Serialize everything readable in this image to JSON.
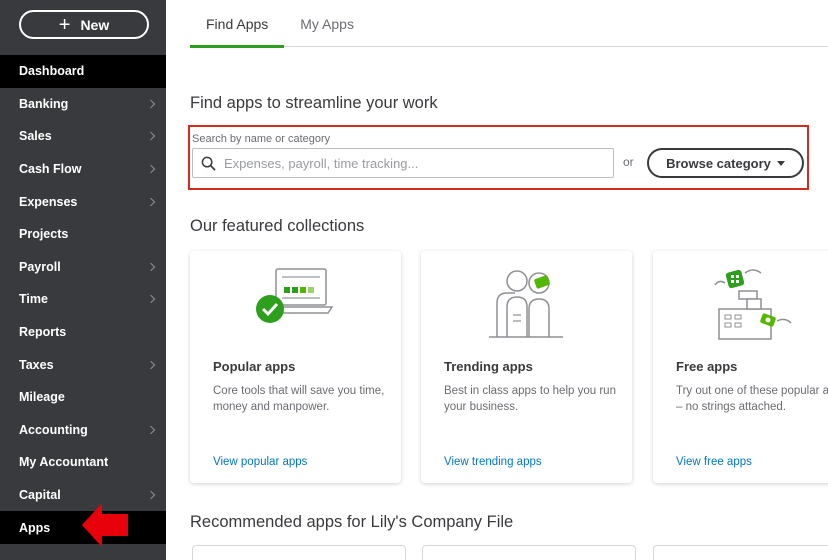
{
  "sidebar": {
    "new_button": {
      "label": "New"
    },
    "items": [
      {
        "label": "Dashboard",
        "has_chevron": false
      },
      {
        "label": "Banking",
        "has_chevron": true
      },
      {
        "label": "Sales",
        "has_chevron": true
      },
      {
        "label": "Cash Flow",
        "has_chevron": true
      },
      {
        "label": "Expenses",
        "has_chevron": true
      },
      {
        "label": "Projects",
        "has_chevron": false
      },
      {
        "label": "Payroll",
        "has_chevron": true
      },
      {
        "label": "Time",
        "has_chevron": true
      },
      {
        "label": "Reports",
        "has_chevron": false
      },
      {
        "label": "Taxes",
        "has_chevron": true
      },
      {
        "label": "Mileage",
        "has_chevron": false
      },
      {
        "label": "Accounting",
        "has_chevron": true
      },
      {
        "label": "My Accountant",
        "has_chevron": false
      },
      {
        "label": "Capital",
        "has_chevron": true
      },
      {
        "label": "Apps",
        "has_chevron": false,
        "active": true
      }
    ]
  },
  "tabs": [
    {
      "label": "Find Apps",
      "active": true
    },
    {
      "label": "My Apps",
      "active": false
    }
  ],
  "find": {
    "heading": "Find apps to streamline your work",
    "search_label": "Search by name or category",
    "search_placeholder": "Expenses, payroll, time tracking...",
    "or_text": "or",
    "browse_label": "Browse category"
  },
  "featured": {
    "heading": "Our featured collections",
    "cards": [
      {
        "title": "Popular apps",
        "desc": "Core tools that will save you time, money and manpower.",
        "link": "View popular apps",
        "icon": "laptop-check-icon"
      },
      {
        "title": "Trending apps",
        "desc": "Best in class apps to help you run your business.",
        "link": "View trending apps",
        "icon": "people-trending-icon"
      },
      {
        "title": "Free apps",
        "desc": "Try out one of these popular apps – no strings attached.",
        "link": "View free apps",
        "icon": "register-free-icon"
      }
    ]
  },
  "recommended": {
    "heading": "Recommended apps for Lily's Company File"
  },
  "colors": {
    "sidebar_bg": "#393a3d",
    "active_bg": "#000000",
    "accent_green": "#2ca01c",
    "link_blue": "#0077c5",
    "highlight_red": "#d52b1e",
    "pointer_red": "#e8000b"
  }
}
